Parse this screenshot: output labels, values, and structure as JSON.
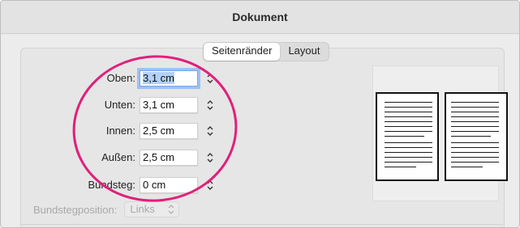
{
  "window": {
    "title": "Dokument"
  },
  "tabs": [
    {
      "label": "Seitenränder",
      "active": true
    },
    {
      "label": "Layout",
      "active": false
    }
  ],
  "margins": [
    {
      "label": "Oben:",
      "value": "3,1 cm",
      "focused": true
    },
    {
      "label": "Unten:",
      "value": "3,1 cm",
      "focused": false
    },
    {
      "label": "Innen:",
      "value": "2,5 cm",
      "focused": false
    },
    {
      "label": "Außen:",
      "value": "2,5 cm",
      "focused": false
    },
    {
      "label": "Bundsteg:",
      "value": "0 cm",
      "focused": false
    }
  ],
  "gutter_position": {
    "label": "Bundstegposition:",
    "value": "Links",
    "enabled": false
  },
  "colors": {
    "annotation": "#e0207a",
    "focus_ring": "#9cc1f4",
    "selection": "#b3d1f7"
  }
}
